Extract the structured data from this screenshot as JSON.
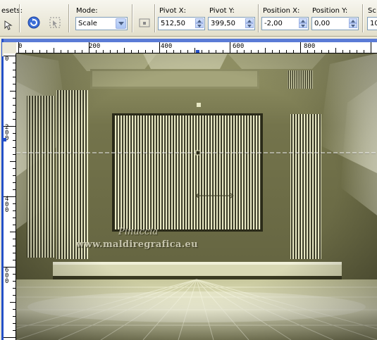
{
  "toolbar": {
    "presets_label": "esets:",
    "mode_label": "Mode:",
    "mode_value": "Scale",
    "pivot_x_label": "Pivot X:",
    "pivot_x_value": "512,50",
    "pivot_y_label": "Pivot Y:",
    "pivot_y_value": "399,50",
    "position_x_label": "Position X:",
    "position_x_value": "-2,00",
    "position_y_label": "Position Y:",
    "position_y_value": "0,00",
    "scale_label": "Sc",
    "scale_value": "10"
  },
  "ruler": {
    "h_labels": [
      "0",
      "200",
      "400",
      "600",
      "800"
    ],
    "v_labels": [
      "0",
      "2 0 0",
      "4 0 0",
      "6 0 0"
    ]
  },
  "canvas": {
    "watermark_name": "Pinuccia",
    "watermark_url": "www.maldiregrafica.eu"
  },
  "colors": {
    "wall": "#6d6d48",
    "stripe_light": "#e8e8c4",
    "stripe_dark": "#2a2a18",
    "accent_blue": "#2450c8"
  }
}
